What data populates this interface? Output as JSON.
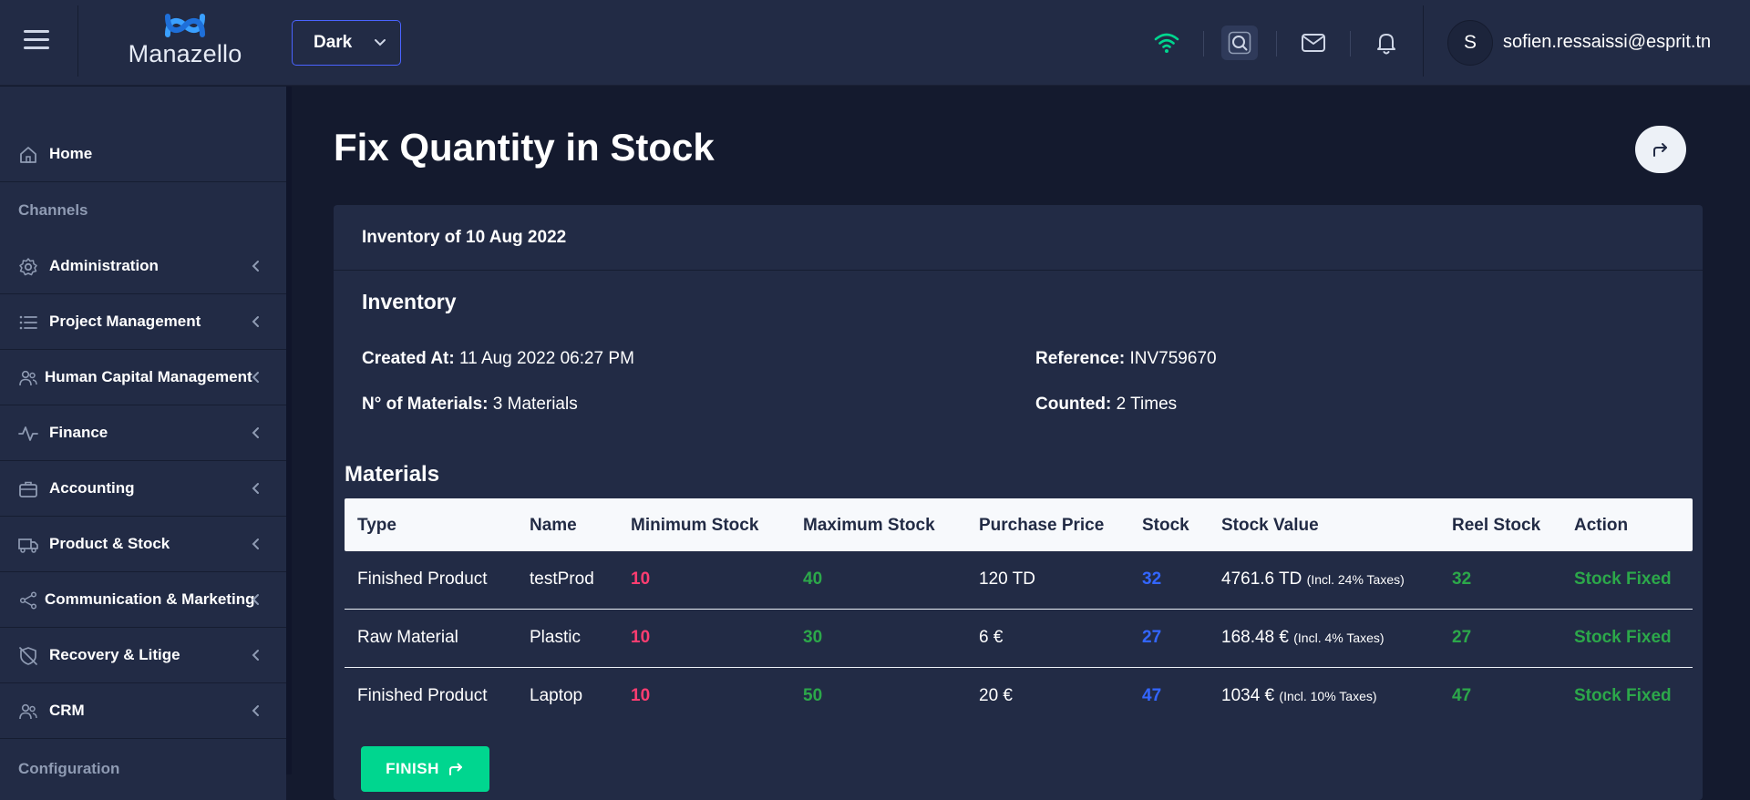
{
  "header": {
    "brand": "Manazello",
    "theme_value": "Dark",
    "user_initial": "S",
    "user_email": "sofien.ressaissi@esprit.tn"
  },
  "sidebar": {
    "items": [
      {
        "label": "Home",
        "icon": "home-icon"
      },
      {
        "heading": "Channels"
      },
      {
        "label": "Administration",
        "icon": "gear-icon"
      },
      {
        "label": "Project Management",
        "icon": "list-icon"
      },
      {
        "label": "Human Capital Management",
        "icon": "people-icon"
      },
      {
        "label": "Finance",
        "icon": "activity-icon"
      },
      {
        "label": "Accounting",
        "icon": "briefcase-icon"
      },
      {
        "label": "Product & Stock",
        "icon": "car-icon"
      },
      {
        "label": "Communication & Marketing",
        "icon": "share-icon"
      },
      {
        "label": "Recovery & Litige",
        "icon": "shield-off-icon"
      },
      {
        "label": "CRM",
        "icon": "people-icon"
      },
      {
        "heading": "Configuration"
      }
    ]
  },
  "main": {
    "page_title": "Fix Quantity in Stock",
    "card_header": "Inventory of 10 Aug 2022",
    "inventory_title": "Inventory",
    "fields": {
      "created_label": "Created At:",
      "created_value": "11 Aug 2022 06:27 PM",
      "reference_label": "Reference:",
      "reference_value": "INV759670",
      "materials_label": "N° of Materials:",
      "materials_value": "3 Materials",
      "counted_label": "Counted:",
      "counted_value": "2 Times"
    },
    "materials_title": "Materials",
    "table": {
      "headers": [
        "Type",
        "Name",
        "Minimum Stock",
        "Maximum Stock",
        "Purchase Price",
        "Stock",
        "Stock Value",
        "Reel Stock",
        "Action"
      ],
      "rows": [
        {
          "type": "Finished Product",
          "name": "testProd",
          "min": "10",
          "max": "40",
          "price": "120 TD",
          "stock": "32",
          "value": "4761.6 TD",
          "tax": "(Incl. 24% Taxes)",
          "reel": "32",
          "action": "Stock Fixed"
        },
        {
          "type": "Raw Material",
          "name": "Plastic",
          "min": "10",
          "max": "30",
          "price": "6 €",
          "stock": "27",
          "value": "168.48 €",
          "tax": "(Incl. 4% Taxes)",
          "reel": "27",
          "action": "Stock Fixed"
        },
        {
          "type": "Finished Product",
          "name": "Laptop",
          "min": "10",
          "max": "50",
          "price": "20 €",
          "stock": "47",
          "value": "1034 €",
          "tax": "(Incl. 10% Taxes)",
          "reel": "47",
          "action": "Stock Fixed"
        }
      ]
    },
    "finish_label": "FINISH"
  },
  "colors": {
    "header_bg": "#222b45",
    "page_bg": "#141a2e",
    "accent_blue": "#3366ff",
    "success": "#00d68f",
    "danger": "#ff3d71",
    "green_text": "#2ca84a",
    "wifi": "#00d68f"
  }
}
